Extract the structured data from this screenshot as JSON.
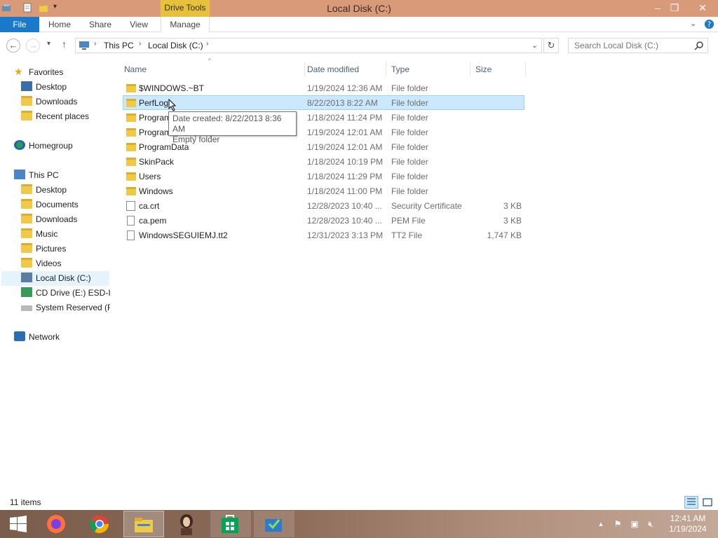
{
  "window": {
    "title": "Local Disk (C:)",
    "contextual_tab": "Drive Tools"
  },
  "ribbon": {
    "tabs": [
      "File",
      "Home",
      "Share",
      "View",
      "Manage"
    ]
  },
  "address": {
    "crumbs": [
      "This PC",
      "Local Disk (C:)"
    ]
  },
  "search": {
    "placeholder": "Search Local Disk (C:)"
  },
  "nav": {
    "items": [
      {
        "label": "Favorites",
        "icon": "star-icon"
      },
      {
        "label": "Desktop",
        "icon": "desktop-icon"
      },
      {
        "label": "Downloads",
        "icon": "downloads-folder-icon"
      },
      {
        "label": "Recent places",
        "icon": "recent-places-icon"
      },
      {
        "label": "Homegroup",
        "icon": "homegroup-icon"
      },
      {
        "label": "This PC",
        "icon": "computer-icon"
      },
      {
        "label": "Desktop",
        "icon": "folder-icon"
      },
      {
        "label": "Documents",
        "icon": "folder-icon"
      },
      {
        "label": "Downloads",
        "icon": "folder-icon"
      },
      {
        "label": "Music",
        "icon": "folder-icon"
      },
      {
        "label": "Pictures",
        "icon": "folder-icon"
      },
      {
        "label": "Videos",
        "icon": "folder-icon"
      },
      {
        "label": "Local Disk (C:)",
        "icon": "drive-icon"
      },
      {
        "label": "CD Drive (E:) ESD-ISO",
        "icon": "cd-drive-icon"
      },
      {
        "label": "System Reserved (F:)",
        "icon": "drive-icon"
      },
      {
        "label": "Network",
        "icon": "network-icon"
      }
    ]
  },
  "columns": {
    "name": "Name",
    "date": "Date modified",
    "type": "Type",
    "size": "Size"
  },
  "files": [
    {
      "name": "$WINDOWS.~BT",
      "date": "1/19/2024 12:36 AM",
      "type": "File folder",
      "size": ""
    },
    {
      "name": "PerfLogs",
      "date": "8/22/2013 8:22 AM",
      "type": "File folder",
      "size": ""
    },
    {
      "name": "Program Files",
      "date": "1/18/2024 11:24 PM",
      "type": "File folder",
      "size": ""
    },
    {
      "name": "Program Files (x86)",
      "date": "1/19/2024 12:01 AM",
      "type": "File folder",
      "size": ""
    },
    {
      "name": "ProgramData",
      "date": "1/19/2024 12:01 AM",
      "type": "File folder",
      "size": ""
    },
    {
      "name": "SkinPack",
      "date": "1/18/2024 10:19 PM",
      "type": "File folder",
      "size": ""
    },
    {
      "name": "Users",
      "date": "1/18/2024 11:29 PM",
      "type": "File folder",
      "size": ""
    },
    {
      "name": "Windows",
      "date": "1/18/2024 11:00 PM",
      "type": "File folder",
      "size": ""
    },
    {
      "name": "ca.crt",
      "date": "12/28/2023 10:40 ...",
      "type": "Security Certificate",
      "size": "3 KB"
    },
    {
      "name": "ca.pem",
      "date": "12/28/2023 10:40 ...",
      "type": "PEM File",
      "size": "3 KB"
    },
    {
      "name": "WindowsSEGUIEMJ.tt2",
      "date": "12/31/2023 3:13 PM",
      "type": "TT2 File",
      "size": "1,747 KB"
    }
  ],
  "tooltip": {
    "line1": "Date created: 8/22/2013 8:36 AM",
    "line2": "Empty folder"
  },
  "status": {
    "item_count": "11 items"
  },
  "taskbar": {
    "apps": [
      "start-icon",
      "firefox-icon",
      "chrome-icon",
      "file-explorer-icon",
      "portrait-app-icon",
      "store-icon",
      "installer-icon"
    ],
    "time": "12:41 AM",
    "date": "1/19/2024"
  },
  "colors": {
    "accent": "#1979ca",
    "titlebar": "#d99a7a",
    "contextual": "#e6c13b",
    "selection": "#cce8ff"
  }
}
